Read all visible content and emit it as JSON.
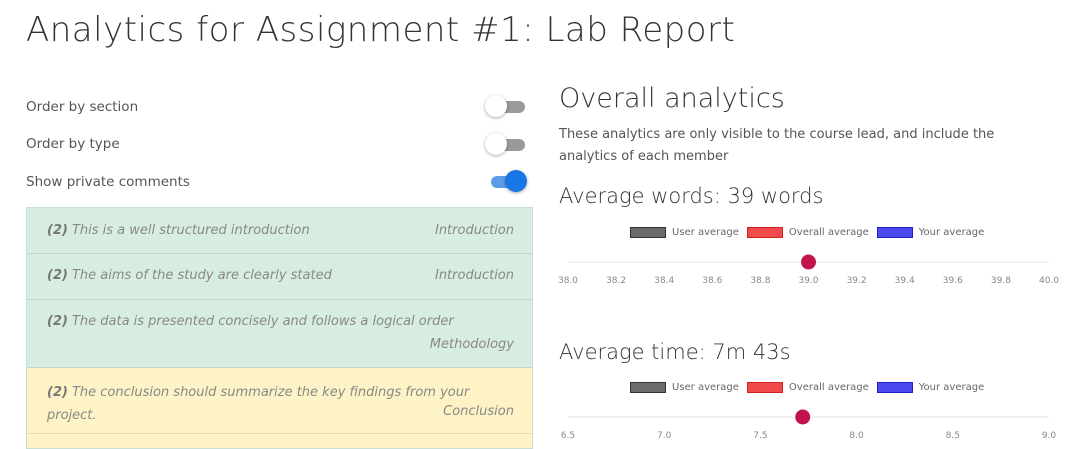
{
  "page": {
    "title": "Analytics for Assignment #1: Lab Report"
  },
  "options": [
    {
      "label": "Order by section",
      "on": false
    },
    {
      "label": "Order by type",
      "on": false
    },
    {
      "label": "Show private comments",
      "on": true
    }
  ],
  "comments": [
    {
      "count": "(2)",
      "text": "This is a well structured introduction",
      "section": "Introduction",
      "color": "green"
    },
    {
      "count": "(2)",
      "text": "The aims of the study are clearly stated",
      "section": "Introduction",
      "color": "green"
    },
    {
      "count": "(2)",
      "text": "The data is presented concisely and follows a logical order",
      "section": "Methodology",
      "color": "green"
    },
    {
      "count": "(2)",
      "text": "The conclusion should summarize the key findings from your project.",
      "section": "Conclusion",
      "color": "yellow"
    }
  ],
  "overall": {
    "heading": "Overall analytics",
    "description": "These analytics are only visible to the course lead, and include the analytics of each member"
  },
  "legend": {
    "user": "User average",
    "overall": "Overall average",
    "yours": "Your average"
  },
  "colors": {
    "user": "#6b6b6b",
    "overall": "#f04b4b",
    "yours": "#4a4af0",
    "marker": "#c0144a",
    "green_bg": "#d7ede1",
    "yellow_bg": "#fdf3c6",
    "toggle_on": "#1976e8"
  },
  "words": {
    "heading": "Average words: 39 words",
    "ticks": [
      "38.0",
      "38.2",
      "38.4",
      "38.6",
      "38.8",
      "39.0",
      "39.2",
      "39.4",
      "39.6",
      "39.8",
      "40.0"
    ],
    "value": 39.0,
    "range": [
      38.0,
      40.0
    ]
  },
  "time": {
    "heading": "Average time: 7m 43s",
    "ticks": [
      "6.5",
      "7.0",
      "7.5",
      "8.0",
      "8.5",
      "9.0"
    ],
    "value": 7.72,
    "range": [
      6.5,
      9.0
    ]
  }
}
